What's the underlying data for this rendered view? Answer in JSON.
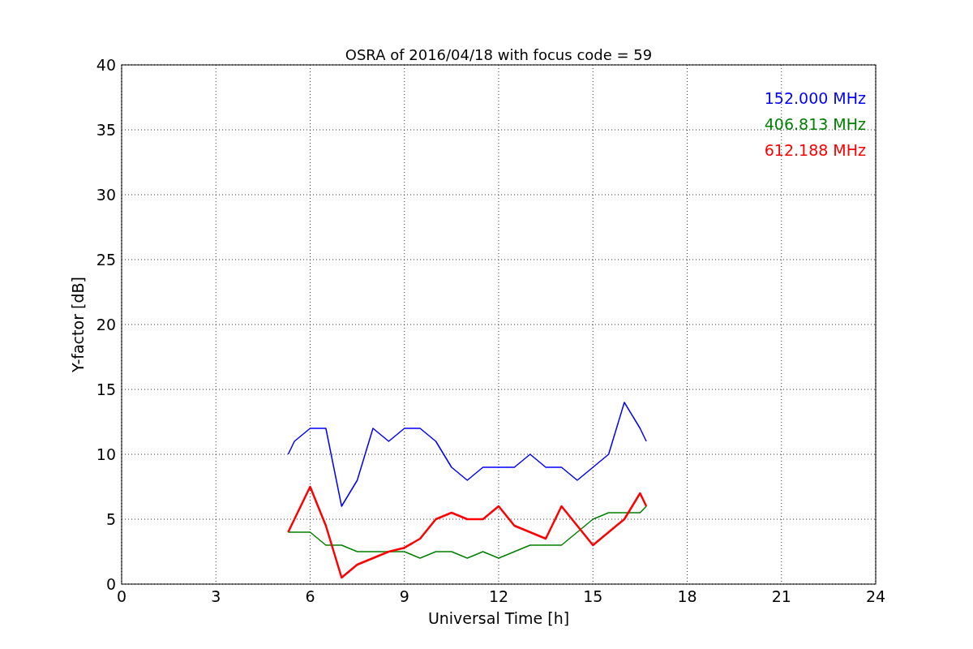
{
  "figure": {
    "chart_data": {
      "type": "line",
      "title": "OSRA of 2016/04/18 with focus code = 59",
      "xlabel": "Universal Time [h]",
      "ylabel": "Y-factor [dB]",
      "x": [
        5.3,
        5.5,
        6,
        6.5,
        7,
        7.5,
        8,
        8.5,
        9,
        9.5,
        10,
        10.5,
        11,
        11.5,
        12,
        12.5,
        13,
        13.5,
        14,
        14.5,
        15,
        15.5,
        16,
        16.5,
        16.7
      ],
      "series": [
        {
          "name": "152.000 MHz",
          "color": "#0000ff",
          "values": [
            10,
            11,
            12,
            12,
            6,
            8,
            12,
            11,
            12,
            12,
            11,
            9,
            8,
            9,
            9,
            9,
            10,
            9,
            9,
            8,
            9,
            10,
            14,
            12,
            11
          ]
        },
        {
          "name": "406.813 MHz",
          "color": "#008000",
          "values": [
            4,
            4,
            4,
            3,
            3,
            2.5,
            2.5,
            2.5,
            2.5,
            2,
            2.5,
            2.5,
            2,
            2.5,
            2,
            2.5,
            3,
            3,
            3,
            4,
            5,
            5.5,
            5.5,
            5.5,
            6
          ]
        },
        {
          "name": "612.188 MHz",
          "color": "#ff0000",
          "values": [
            4,
            5,
            7.5,
            4.5,
            0.5,
            1.5,
            2,
            2.5,
            2.8,
            3.5,
            5,
            5.5,
            5,
            5,
            6,
            4.5,
            4,
            3.5,
            6,
            4.5,
            3,
            4,
            5,
            7,
            6
          ]
        }
      ],
      "xlim": [
        0,
        24
      ],
      "ylim": [
        0,
        40
      ],
      "xticks": [
        0,
        3,
        6,
        9,
        12,
        15,
        18,
        21,
        24
      ],
      "yticks": [
        0,
        5,
        10,
        15,
        20,
        25,
        30,
        35,
        40
      ],
      "grid": true
    }
  }
}
